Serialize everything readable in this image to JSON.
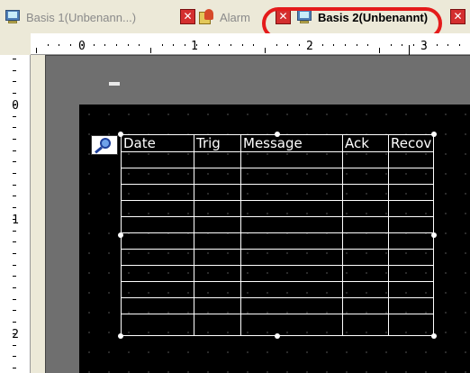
{
  "tabs": [
    {
      "label": "Basis 1(Unbenann...)",
      "active": false,
      "icon": "monitor-icon"
    },
    {
      "label": "Alarm",
      "active": false,
      "icon": "alarm-icon"
    },
    {
      "label": "Basis 2(Unbenannt)",
      "active": true,
      "icon": "monitor-icon"
    }
  ],
  "close_glyph": "✕",
  "ruler": {
    "horizontal_labels": [
      "0",
      "1",
      "2",
      "3"
    ],
    "vertical_labels": [
      "0",
      "1",
      "2"
    ]
  },
  "alarm_table": {
    "columns": [
      "Date",
      "Trig",
      "Message",
      "Ack",
      "Recov"
    ]
  },
  "colors": {
    "highlight_ring": "#e41b1b",
    "screen_bg": "#000000",
    "panel_bg": "#6f6f6f",
    "close_button": "#d42f2f"
  }
}
